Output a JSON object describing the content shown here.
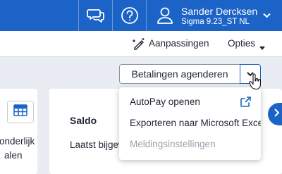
{
  "header": {
    "user_name": "Sander Dercksen",
    "user_subtitle": "Sigma 9.23_ST NL",
    "icons": [
      "chat-icon",
      "help-icon",
      "user-icon",
      "chevron-down-icon"
    ]
  },
  "toolbar": {
    "customizations_label": "Aanpassingen",
    "options_label": "Opties"
  },
  "actions": {
    "schedule_payments_label": "Betalingen agenderen"
  },
  "dropdown_menu": {
    "items": [
      {
        "label": "AutoPay openen",
        "icon": "external-link-icon",
        "disabled": false
      },
      {
        "label": "Exporteren naar Microsoft Excel",
        "disabled": false
      },
      {
        "label": "Meldingsinstellingen",
        "disabled": true
      }
    ]
  },
  "left_card": {
    "line1": "onderlijk",
    "line2": "alen"
  },
  "balance_card": {
    "title": "Saldo",
    "subtitle": "Laatst bijgewerkt"
  },
  "colors": {
    "brand": "#1b63c6",
    "background": "#e9edf3",
    "disabled_text": "#9aa1ad"
  }
}
